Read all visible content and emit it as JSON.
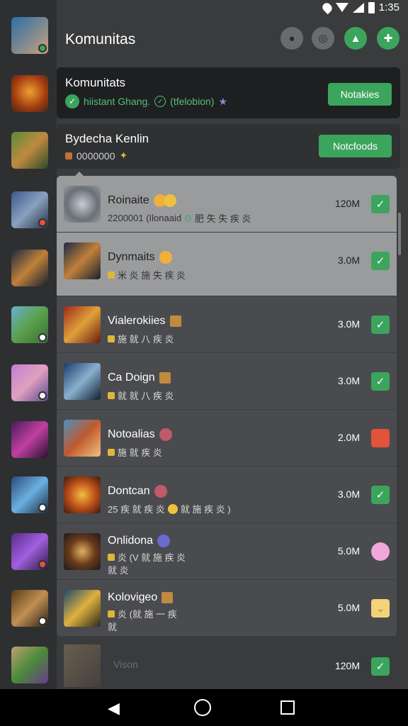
{
  "status_bar": {
    "time": "1:35"
  },
  "header": {
    "title": "Komunitas"
  },
  "card1": {
    "title": "Komunitats",
    "subtitle": "hiistant Ghang.",
    "subtitle_extra": "(tfelobion)",
    "button": "Notakies"
  },
  "card2": {
    "title": "Bydecha Kenlin",
    "subtitle": "0000000",
    "button": "Notcfoods"
  },
  "rows": [
    {
      "title": "Roinaite",
      "sub": "2200001 (Ilonaaid",
      "sub2": "肥 失 失 疾 炎",
      "size": "120M",
      "state": "check"
    },
    {
      "title": "Dynmaits",
      "sub": "米 炎 施 失 疾 炎",
      "size": "3.0M",
      "state": "check"
    },
    {
      "title": "Vialerokiies",
      "sub": "施 就 八 疾 炎",
      "size": "3.0M",
      "state": "check"
    },
    {
      "title": "Ca Doign",
      "sub": "就 就 八 疾 炎",
      "size": "3.0M",
      "state": "check"
    },
    {
      "title": "Notoalias",
      "sub": "施 就 疾 炎",
      "size": "2.0M",
      "state": "orange"
    },
    {
      "title": "Dontcan",
      "sub": "25 疾 就 疾 炎",
      "sub2": "就 施 疾 炎 )",
      "size": "3.0M",
      "state": "check"
    },
    {
      "title": "Onlidona",
      "sub": "炎 (V 就 施 疾 炎",
      "sub3": "就 炎",
      "size": "5.0M",
      "state": "pink"
    },
    {
      "title": "Kolovigeo",
      "sub": "炎 (就 施 一 疾",
      "sub3": "就",
      "size": "5.0M",
      "state": "yellow"
    }
  ],
  "dim_row": {
    "title": "Vison",
    "size": "120M"
  },
  "icons": {
    "check": "✓"
  }
}
